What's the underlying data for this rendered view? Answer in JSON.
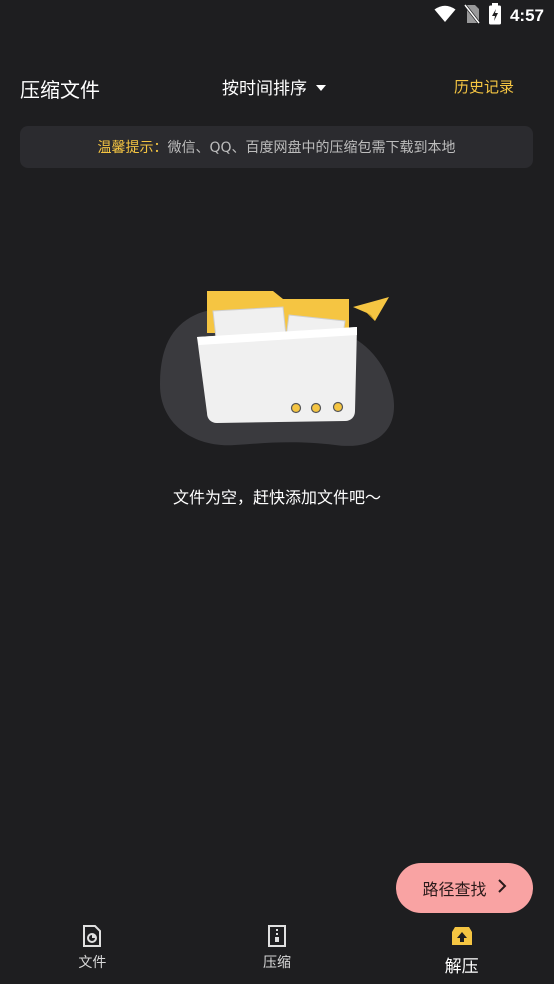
{
  "status_bar": {
    "time": "4:57",
    "icons": [
      "wifi-icon",
      "no-sim-icon",
      "battery-charging-icon"
    ]
  },
  "header": {
    "title": "压缩文件",
    "sort_label": "按时间排序",
    "history_label": "历史记录"
  },
  "tip": {
    "label": "温馨提示：",
    "text": "微信、QQ、百度网盘中的压缩包需下载到本地"
  },
  "empty_state": {
    "message": "文件为空，赶快添加文件吧～"
  },
  "fab": {
    "label": "路径查找",
    "icon": "chevron-right-icon"
  },
  "bottom_nav": {
    "items": [
      {
        "label": "文件",
        "icon": "file-icon",
        "active": false
      },
      {
        "label": "压缩",
        "icon": "zip-icon",
        "active": false
      },
      {
        "label": "解压",
        "icon": "unzip-icon",
        "active": true
      }
    ]
  },
  "colors": {
    "background": "#1e1e20",
    "accent": "#f5c542",
    "fab": "#f9a3a3",
    "banner": "#2b2b2f"
  }
}
